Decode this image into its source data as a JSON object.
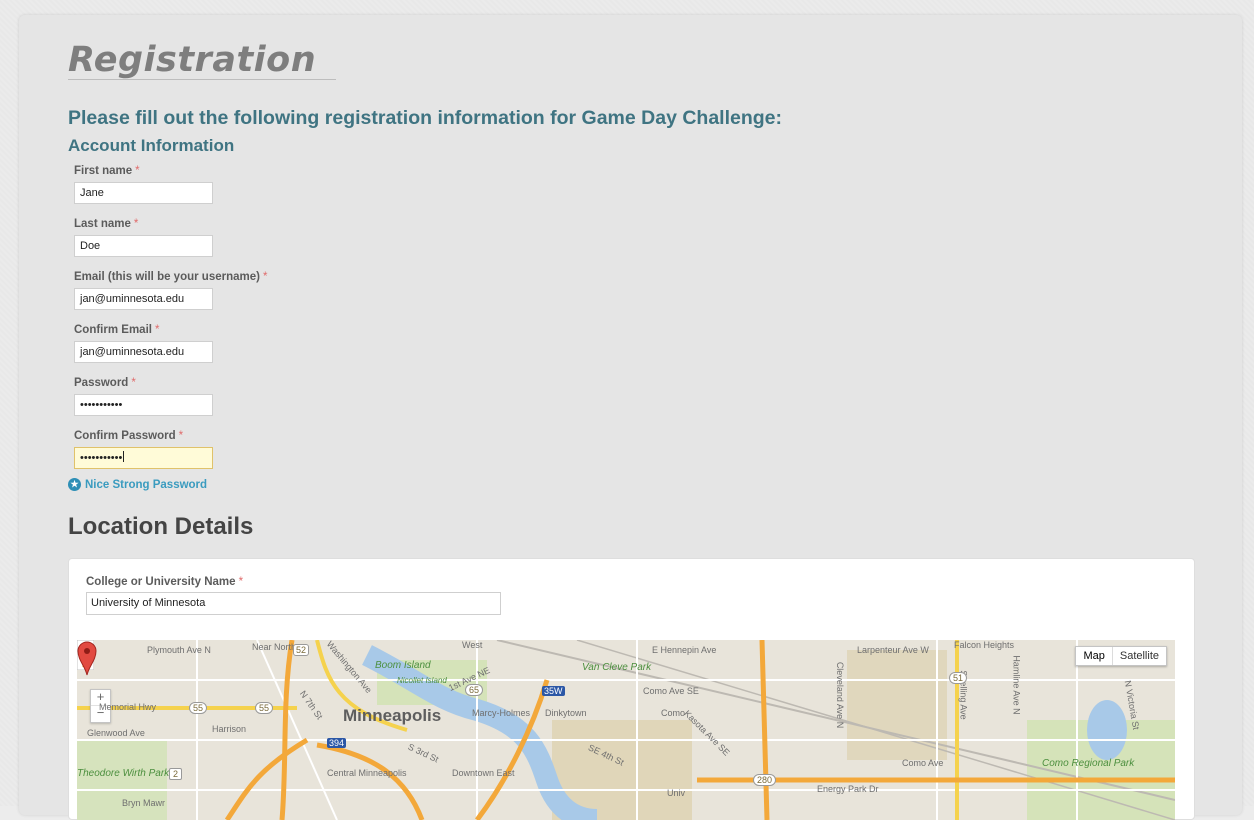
{
  "page": {
    "title": "Registration",
    "intro": "Please fill out the following registration information for Game Day Challenge:",
    "section_account": "Account Information",
    "section_location": "Location Details",
    "required_mark": "*"
  },
  "account": {
    "first_name": {
      "label": "First name",
      "value": "Jane"
    },
    "last_name": {
      "label": "Last name",
      "value": "Doe"
    },
    "email": {
      "label": "Email (this will be your username)",
      "value": "jan@uminnesota.edu"
    },
    "confirm_email": {
      "label": "Confirm Email",
      "value": "jan@uminnesota.edu"
    },
    "password": {
      "label": "Password",
      "value": "•••••••••••"
    },
    "confirm_password": {
      "label": "Confirm Password",
      "value": "•••••••••••"
    },
    "strength_text": "Nice Strong Password"
  },
  "location": {
    "college_label": "College or University Name",
    "college_value": "University of Minnesota"
  },
  "map": {
    "type_map": "Map",
    "type_satellite": "Satellite",
    "zoom_in": "+",
    "zoom_out": "−",
    "city": "Minneapolis",
    "labels": {
      "plymouth": "Plymouth Ave N",
      "near_north": "Near North",
      "washington": "Washington Ave",
      "west": "West",
      "boom_island": "Boom Island",
      "nicollet_island": "Nicollet Island",
      "first_ave_ne": "1st Ave NE",
      "van_cleve": "Van Cleve Park",
      "como_ave_se": "Como Ave SE",
      "como": "Como",
      "e_hennepin": "E Hennepin Ave",
      "larpenteur": "Larpenteur Ave W",
      "falcon_heights": "Falcon Heights",
      "memorial_hwy": "Memorial Hwy",
      "harrison": "Harrison",
      "glenwood": "Glenwood Ave",
      "n7th": "N 7th St",
      "marcy_holmes": "Marcy-Holmes",
      "dinkytown": "Dinkytown",
      "kasota": "Kasota Ave SE",
      "cleveland": "Cleveland Ave N",
      "snelling": "Snelling Ave",
      "hamline": "Hamline Ave N",
      "n_victoria": "N Victoria St",
      "como_ave_w": "Como Ave",
      "como_regional": "Como Regional Park",
      "theodore_park": "Theodore Wirth Park",
      "s3rd": "S 3rd St",
      "se4th": "SE 4th St",
      "downtown_east": "Downtown East",
      "central": "Central Minneapolis",
      "energy_park": "Energy Park Dr",
      "bryn_mawr": "Bryn Mawr",
      "univ": "Univ"
    },
    "shields": {
      "s55a": "55",
      "s55b": "55",
      "s52": "52",
      "s65": "65",
      "s35w": "35W",
      "s394": "394",
      "s280": "280",
      "s51": "51",
      "s2": "2"
    }
  }
}
